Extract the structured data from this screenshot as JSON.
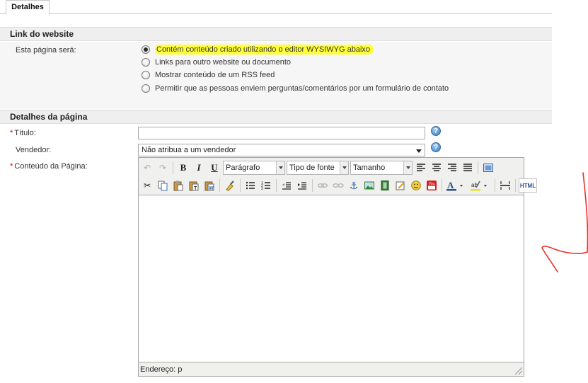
{
  "tabs": [
    {
      "label": "Detalhes",
      "active": true
    }
  ],
  "link_section": {
    "title": "Link do website",
    "field_label": "Esta página será:",
    "options": [
      {
        "label": "Contém conteúdo criado utilizando o editor WYSIWYG abaixo",
        "checked": true,
        "highlighted": true
      },
      {
        "label": "Links para outro website ou documento",
        "checked": false
      },
      {
        "label": "Mostrar conteúdo de um RSS feed",
        "checked": false
      },
      {
        "label": "Permitir que as pessoas enviem perguntas/comentários por um formulário de contato",
        "checked": false
      }
    ]
  },
  "details_section": {
    "title": "Detalhes da página",
    "required_marker": "*",
    "title_label": "Título:",
    "title_value": "",
    "vendor_label": "Vendedor:",
    "vendor_value": "Não atribua a um vendedor",
    "content_label": "Conteúdo da Página:"
  },
  "editor": {
    "format_select": "Parágrafo",
    "font_select": "Tipo de fonte",
    "size_select": "Tamanho",
    "status_path": "Endereço: p",
    "html_button": "HTML",
    "youtube_icon": "You"
  },
  "colors": {
    "highlight": "#ffff3a",
    "required": "#cc0000",
    "section_bg": "#efefef",
    "annotation": "#e8322a"
  }
}
